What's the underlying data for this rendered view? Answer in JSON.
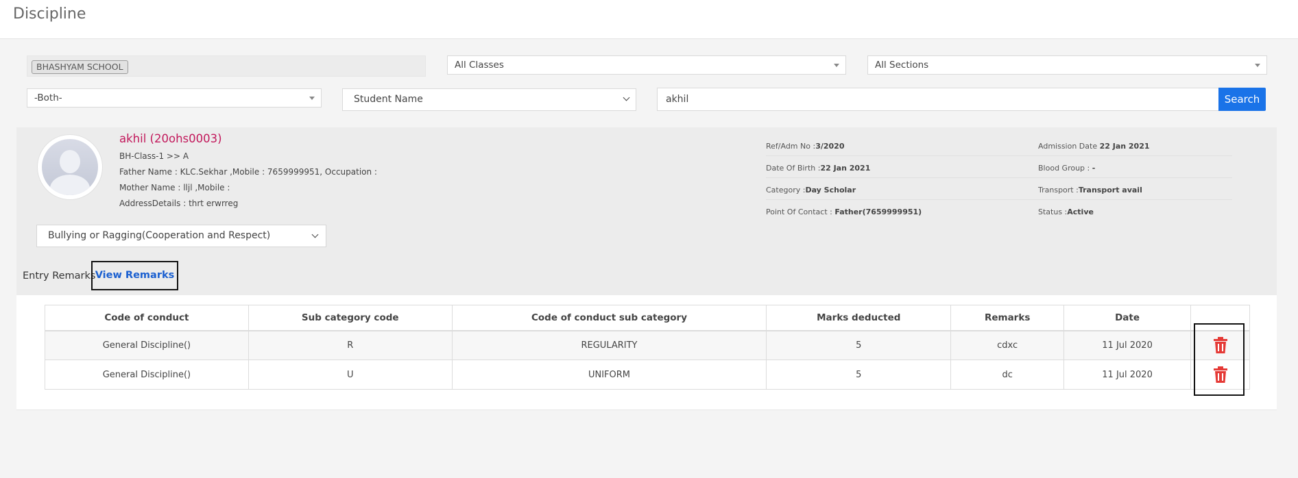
{
  "page": {
    "title": "Discipline"
  },
  "filters": {
    "school": "BHASHYAM SCHOOL",
    "classes": "All Classes",
    "sections": "All Sections",
    "gender": "-Both-",
    "search_by": "Student Name",
    "search_value": "akhil",
    "search_button": "Search"
  },
  "student": {
    "name": "akhil (20ohs0003)",
    "class": "BH-Class-1 >> A",
    "father": "Father Name : KLC.Sekhar ,Mobile : 7659999951, Occupation :",
    "mother": "Mother Name : lljl ,Mobile :",
    "address": "AddressDetails : thrt erwrreg",
    "ref_label": "Ref/Adm No :",
    "ref_value": "3/2020",
    "admission_label": "Admission Date",
    "admission_value": "22 Jan 2021",
    "dob_label": "Date Of Birth :",
    "dob_value": "22 Jan 2021",
    "blood_label": "Blood Group :",
    "blood_value": "-",
    "category_label": "Category :",
    "category_value": "Day Scholar",
    "transport_label": "Transport :",
    "transport_value": "Transport avail",
    "contact_label": "Point Of Contact :",
    "contact_value": "Father(7659999951)",
    "status_label": "Status :",
    "status_value": "Active"
  },
  "category_select": "Bullying or Ragging(Cooperation and Respect)",
  "tabs": {
    "entry": "Entry Remarks",
    "view": "View Remarks"
  },
  "table": {
    "headers": [
      "Code of conduct",
      "Sub category code",
      "Code of conduct sub category",
      "Marks deducted",
      "Remarks",
      "Date"
    ],
    "rows": [
      [
        "General Discipline()",
        "R",
        "REGULARITY",
        "5",
        "cdxc",
        "11 Jul 2020"
      ],
      [
        "General Discipline()",
        "U",
        "UNIFORM",
        "5",
        "dc",
        "11 Jul 2020"
      ]
    ]
  },
  "colors": {
    "accent": "#1a73e8",
    "student_name": "#c2185b",
    "delete": "#e53935"
  },
  "icons": {
    "delete": "trash-icon",
    "avatar": "user-avatar-icon"
  }
}
